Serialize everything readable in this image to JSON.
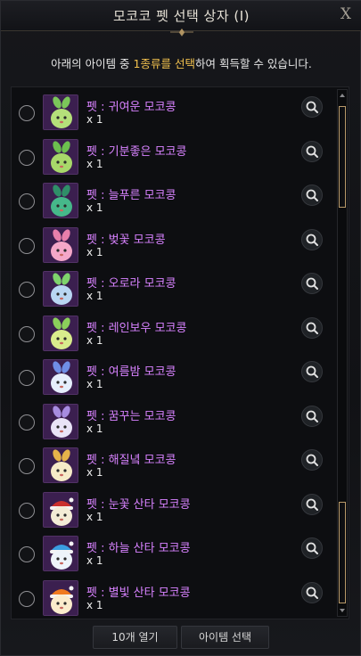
{
  "window": {
    "title": "모코코 펫 선택 상자 (I)",
    "close_label": "X"
  },
  "instruction": {
    "before": "아래의 아이템 중 ",
    "highlight": "1종류를 선택",
    "after": "하여 획득할 수 있습니다."
  },
  "items": [
    {
      "name": "펫 : 귀여운 모코콩",
      "qty": "x 1",
      "color": "#b5e07a",
      "ears": "#7bc65a",
      "hat": ""
    },
    {
      "name": "펫 : 기분좋은 모코콩",
      "qty": "x 1",
      "color": "#a8d86a",
      "ears": "#6cbf4e",
      "hat": ""
    },
    {
      "name": "펫 : 늘푸른 모코콩",
      "qty": "x 1",
      "color": "#46b88a",
      "ears": "#2f8f68",
      "hat": ""
    },
    {
      "name": "펫 : 벚꽃 모코콩",
      "qty": "x 1",
      "color": "#f4a7c8",
      "ears": "#e77fab",
      "hat": ""
    },
    {
      "name": "펫 : 오로라 모코콩",
      "qty": "x 1",
      "color": "#b9d6f2",
      "ears": "#7fd36c",
      "hat": ""
    },
    {
      "name": "펫 : 레인보우 모코콩",
      "qty": "x 1",
      "color": "#d9ec8c",
      "ears": "#8bcf5b",
      "hat": ""
    },
    {
      "name": "펫 : 여름밤 모코콩",
      "qty": "x 1",
      "color": "#e6eefc",
      "ears": "#6f8ee6",
      "hat": ""
    },
    {
      "name": "펫 : 꿈꾸는 모코콩",
      "qty": "x 1",
      "color": "#e9e3f7",
      "ears": "#a78ce0",
      "hat": ""
    },
    {
      "name": "펫 : 해질녘 모코콩",
      "qty": "x 1",
      "color": "#f6ebc8",
      "ears": "#e6b34a",
      "hat": ""
    },
    {
      "name": "펫 : 눈꽃 산타 모코콩",
      "qty": "x 1",
      "color": "#f3ecd6",
      "ears": "#c9302c",
      "hat": "#c9302c"
    },
    {
      "name": "펫 : 하늘 산타 모코콩",
      "qty": "x 1",
      "color": "#eef4fa",
      "ears": "#3a9ee0",
      "hat": "#3a9ee0"
    },
    {
      "name": "펫 : 별빛 산타 모코콩",
      "qty": "x 1",
      "color": "#fbeccc",
      "ears": "#f07a1f",
      "hat": "#f07a1f"
    }
  ],
  "footer": {
    "open_ten_label": "10개 열기",
    "select_label": "아이템 선택"
  },
  "icons": {
    "close": "close-icon",
    "search": "magnifier-icon",
    "radio": "radio-unchecked"
  },
  "colors": {
    "item_name": "#d882ff",
    "highlight": "#f2c14e",
    "scroll_thumb_border": "#b99a6a"
  }
}
